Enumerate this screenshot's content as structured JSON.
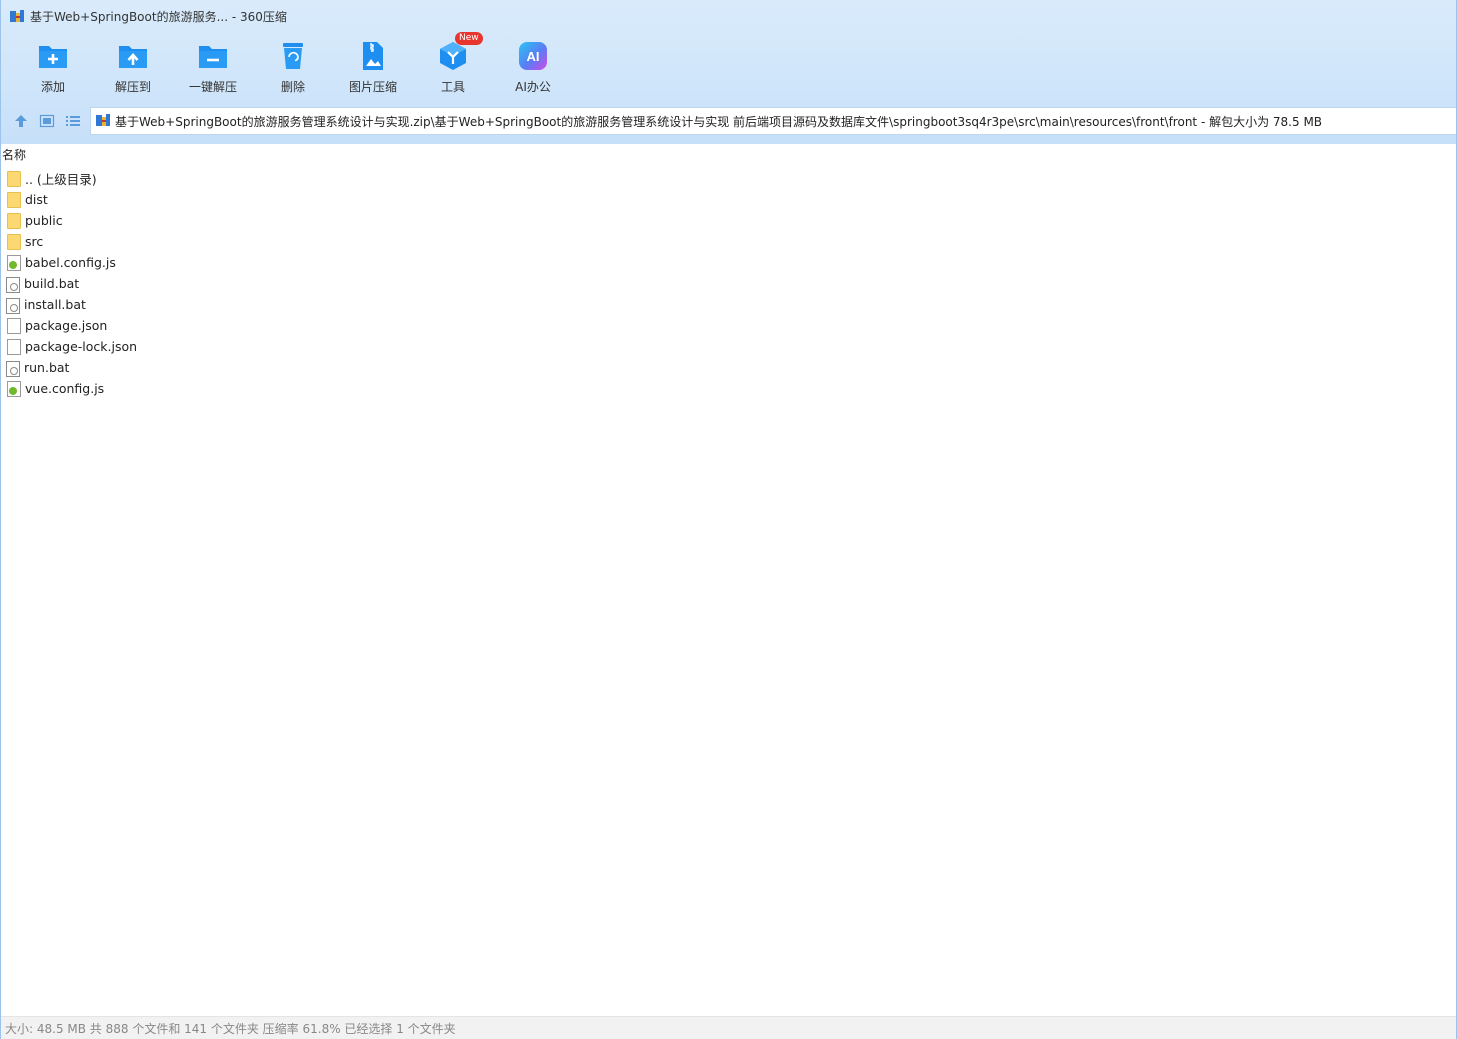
{
  "window": {
    "title": "基于Web+SpringBoot的旅游服务... - 360压缩"
  },
  "toolbar": {
    "items": [
      {
        "label": "添加",
        "icon": "add-folder-icon"
      },
      {
        "label": "解压到",
        "icon": "extract-to-icon"
      },
      {
        "label": "一键解压",
        "icon": "one-click-extract-icon"
      },
      {
        "label": "删除",
        "icon": "delete-icon"
      },
      {
        "label": "图片压缩",
        "icon": "image-compress-icon"
      },
      {
        "label": "工具",
        "icon": "tools-icon",
        "badge": "New"
      },
      {
        "label": "AI办公",
        "icon": "ai-office-icon",
        "icon_text": "AI"
      }
    ]
  },
  "address_bar": {
    "path": "基于Web+SpringBoot的旅游服务管理系统设计与实现.zip\\基于Web+SpringBoot的旅游服务管理系统设计与实现 前后端项目源码及数据库文件\\springboot3sq4r3pe\\src\\main\\resources\\front\\front - 解包大小为 78.5 MB"
  },
  "file_list": {
    "column_name": "名称",
    "rows": [
      {
        "name": ".. (上级目录)",
        "type": "folder"
      },
      {
        "name": "dist",
        "type": "folder"
      },
      {
        "name": "public",
        "type": "folder"
      },
      {
        "name": "src",
        "type": "folder"
      },
      {
        "name": "babel.config.js",
        "type": "js"
      },
      {
        "name": "build.bat",
        "type": "bat"
      },
      {
        "name": "install.bat",
        "type": "bat"
      },
      {
        "name": "package.json",
        "type": "file"
      },
      {
        "name": "package-lock.json",
        "type": "file"
      },
      {
        "name": "run.bat",
        "type": "bat"
      },
      {
        "name": "vue.config.js",
        "type": "js"
      }
    ]
  },
  "status_bar": {
    "text": "大小: 48.5 MB 共 888 个文件和 141 个文件夹 压缩率 61.8% 已经选择 1 个文件夹"
  },
  "colors": {
    "accent": "#1e8ef0",
    "toolbar_bg": "#d3e7fa",
    "badge": "#e8352e",
    "folder": "#fbd871"
  }
}
